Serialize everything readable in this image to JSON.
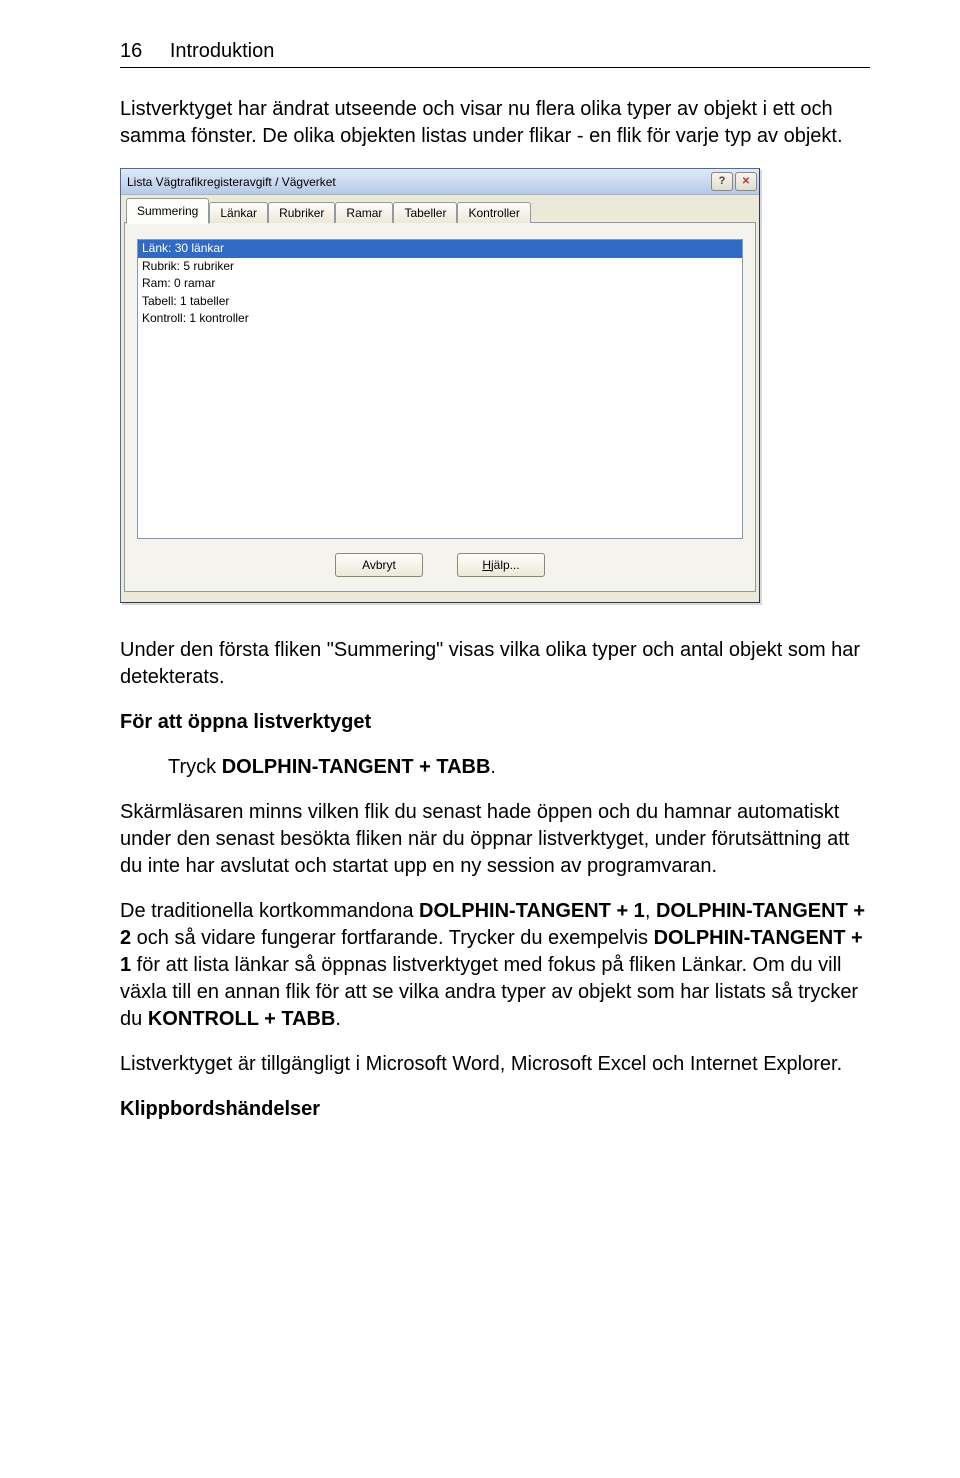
{
  "header": {
    "page_number": "16",
    "chapter": "Introduktion"
  },
  "intro_paragraph": "Listverktyget har ändrat utseende och visar nu flera olika typer av objekt i ett och samma fönster. De olika objekten listas under flikar - en flik för varje typ av objekt.",
  "dialog": {
    "title": "Lista Vägtrafikregisteravgift / Vägverket",
    "tabs": [
      "Summering",
      "Länkar",
      "Rubriker",
      "Ramar",
      "Tabeller",
      "Kontroller"
    ],
    "list_rows": [
      "Länk: 30 länkar",
      "Rubrik: 5 rubriker",
      "Ram: 0 ramar",
      "Tabell: 1 tabeller",
      "Kontroll: 1 kontroller"
    ],
    "selected_row_index": 0,
    "buttons": {
      "cancel": "Avbryt",
      "help": "Hjälp..."
    }
  },
  "after_dialog_paragraph": "Under den första fliken \"Summering\" visas vilka olika typer och antal objekt som har detekterats.",
  "open_heading": "För att öppna listverktyget",
  "open_line_pre": "Tryck ",
  "open_line_kbd": "DOLPHIN-TANGENT + TABB",
  "open_line_post": ".",
  "para_memory": "Skärmläsaren minns vilken flik du senast hade öppen och du hamnar automatiskt under den senast besökta fliken när du öppnar listverktyget, under förutsättning att du inte har avslutat och startat upp en ny session av programvaran.",
  "para_shortcuts": {
    "t1": "De traditionella kortkommandona ",
    "k1": "DOLPHIN-TANGENT + 1",
    "t2": ", ",
    "k2": "DOLPHIN-TANGENT + 2",
    "t3": " och så vidare fungerar fortfarande. Trycker du exempelvis ",
    "k3": "DOLPHIN-TANGENT + 1",
    "t4": " för att lista länkar så öppnas listverktyget med fokus på fliken Länkar. Om du vill växla till en annan flik för att se vilka andra typer av objekt som har listats så trycker du ",
    "k4": "KONTROLL + TABB",
    "t5": "."
  },
  "para_availability": "Listverktyget är tillgängligt i Microsoft Word, Microsoft Excel och Internet Explorer.",
  "section_heading": "Klippbordshändelser"
}
